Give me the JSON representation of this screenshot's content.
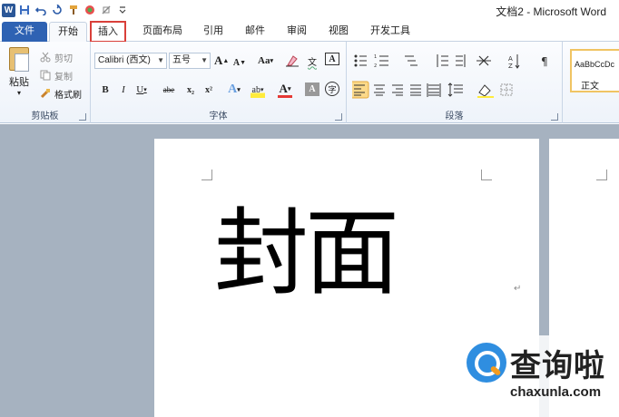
{
  "window": {
    "title": "文档2 - Microsoft Word"
  },
  "quick_access": {
    "logo": "W",
    "icons": [
      "save-icon",
      "undo-icon",
      "redo-icon",
      "format-painter-icon",
      "color-icon",
      "clear-icon",
      "customize-icon"
    ]
  },
  "tabs": [
    {
      "label": "文件"
    },
    {
      "label": "开始"
    },
    {
      "label": "插入"
    },
    {
      "label": "页面布局"
    },
    {
      "label": "引用"
    },
    {
      "label": "邮件"
    },
    {
      "label": "审阅"
    },
    {
      "label": "视图"
    },
    {
      "label": "开发工具"
    }
  ],
  "ribbon": {
    "clipboard": {
      "label": "剪贴板",
      "paste": "粘贴",
      "cut": "剪切",
      "copy": "复制",
      "format_painter": "格式刷"
    },
    "font": {
      "label": "字体",
      "font_name": "Calibri (西文)",
      "font_size": "五号",
      "grow": "A",
      "shrink": "A",
      "change_case": "Aa",
      "bold": "B",
      "italic": "I",
      "underline": "U",
      "strikethrough": "abe",
      "subscript": "x₂",
      "superscript": "x²",
      "text_effects": "A",
      "highlight": "ab",
      "font_color": "A",
      "char_shading": "A",
      "enclose": "字",
      "phonetic": "文",
      "border": "A"
    },
    "paragraph": {
      "label": "段落"
    },
    "styles": {
      "sample": "AaBbCcDc",
      "name": "正文"
    }
  },
  "document": {
    "text": "封面",
    "para_mark": "↵"
  },
  "watermark": {
    "title": "查询啦",
    "site": "chaxunla.com"
  },
  "colors": {
    "file_tab": "#2e62b3",
    "highlight_box": "#d9403a",
    "selected_button": "#fbd98a"
  }
}
